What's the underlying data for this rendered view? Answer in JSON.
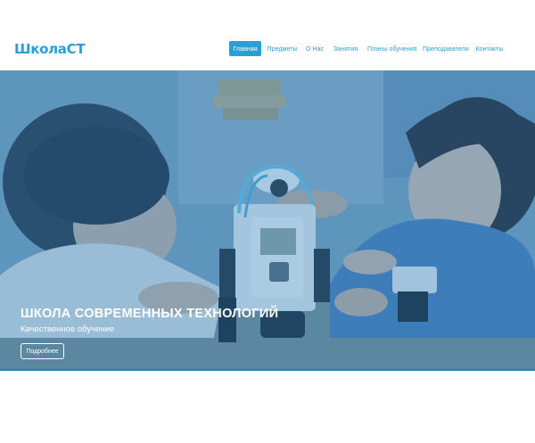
{
  "header": {
    "logo": "ШколаСТ"
  },
  "nav": {
    "items": [
      {
        "label": "Главная",
        "active": true
      },
      {
        "label": "Предметы",
        "active": false
      },
      {
        "label": "О Нас",
        "active": false
      },
      {
        "label": "Занятия",
        "active": false
      },
      {
        "label": "Планы обучения",
        "active": false
      },
      {
        "label": "Преподаватели",
        "active": false
      },
      {
        "label": "Контакты",
        "active": false
      }
    ]
  },
  "hero": {
    "title": "ШКОЛА СОВРЕМЕННЫХ ТЕХНОЛОГИЙ",
    "subtitle": "Качественное обучение",
    "button_label": "Подробнее"
  },
  "colors": {
    "accent": "#2a9fd6",
    "overlay": "#217abb"
  }
}
